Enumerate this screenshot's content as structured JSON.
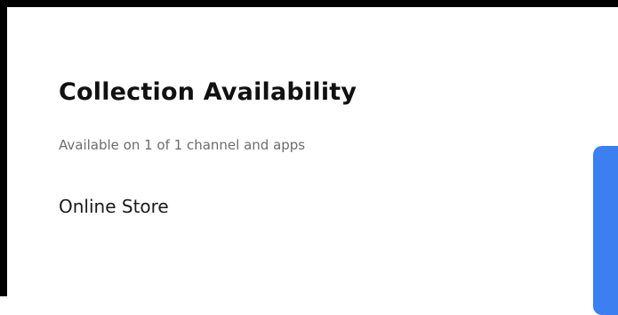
{
  "section": {
    "title": "Collection Availability",
    "subtitle": "Available on 1 of 1 channel and apps"
  },
  "channels": [
    {
      "label": "Online Store"
    }
  ],
  "colors": {
    "accent_button": "#3b7ff0",
    "frame_border": "#000000",
    "subtitle_text": "#6d6d6d"
  }
}
